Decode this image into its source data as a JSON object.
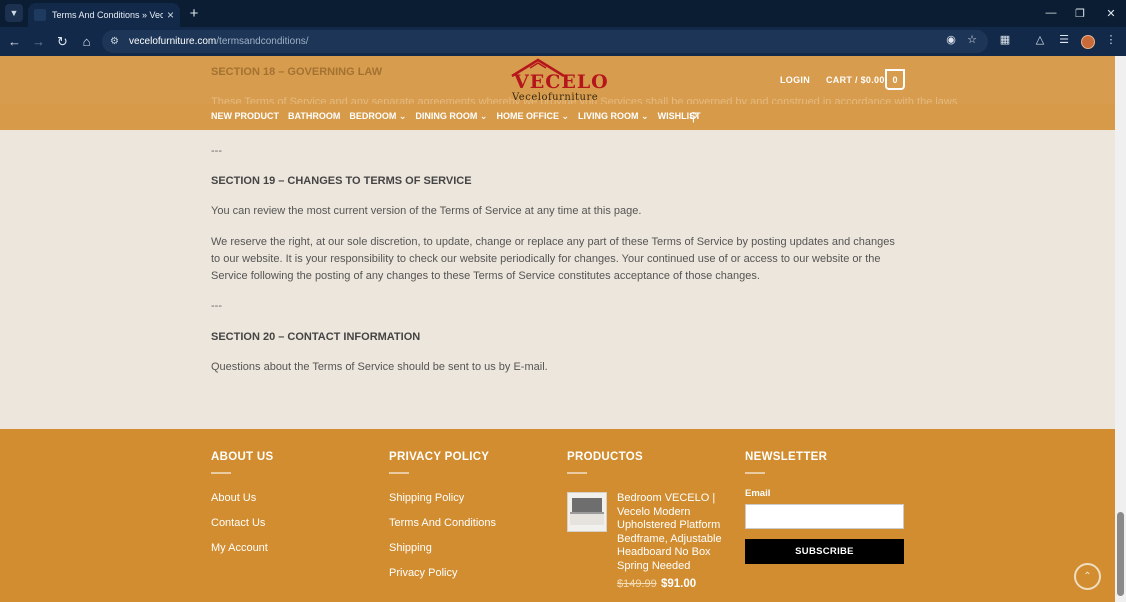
{
  "browser": {
    "tab_title": "Terms And Conditions » Vecelo",
    "url_domain": "vecelofurniture.com",
    "url_path": "/termsandconditions/"
  },
  "header": {
    "ghost_heading": "SECTION 18 – GOVERNING LAW",
    "ghost_text": "These Terms of Service and any separate agreements whereby we provide you Services shall be governed by and construed in accordance with the laws",
    "logo_brand": "VECELO",
    "logo_sub": "Vecelofurniture",
    "login": "LOGIN",
    "cart": "CART / $0.00",
    "cart_count": "0",
    "nav": [
      "NEW PRODUCT",
      "BATHROOM",
      "BEDROOM",
      "DINING ROOM",
      "HOME OFFICE",
      "LIVING ROOM",
      "WISHLIST"
    ]
  },
  "content": {
    "sep1": "---",
    "section19_title": "SECTION 19 – CHANGES TO TERMS OF SERVICE",
    "section19_p1": "You can review the most current version of the Terms of Service at any time at this page.",
    "section19_p2": "We reserve the right, at our sole discretion, to update, change or replace any part of these Terms of Service by posting updates and changes to our website. It is your responsibility to check our website periodically for changes. Your continued use of or access to our website or the Service following the posting of any changes to these Terms of Service constitutes acceptance of those changes.",
    "sep2": "---",
    "section20_title": "SECTION 20 – CONTACT INFORMATION",
    "section20_p1": "Questions about the Terms of Service should be sent to us by E-mail."
  },
  "footer": {
    "about_heading": "ABOUT US",
    "about_links": [
      "About Us",
      "Contact Us",
      "My Account"
    ],
    "privacy_heading": "PRIVACY POLICY",
    "privacy_links": [
      "Shipping Policy",
      "Terms And Conditions",
      "Shipping",
      "Privacy Policy"
    ],
    "products_heading": "PRODUCTOS",
    "product_title": "Bedroom VECELO | Vecelo Modern Upholstered Platform Bedframe, Adjustable Headboard No Box Spring Needed",
    "product_price_old": "$149.99",
    "product_price_new": "$91.00",
    "newsletter_heading": "NEWSLETTER",
    "email_label": "Email",
    "subscribe_label": "SUBSCRIBE"
  }
}
